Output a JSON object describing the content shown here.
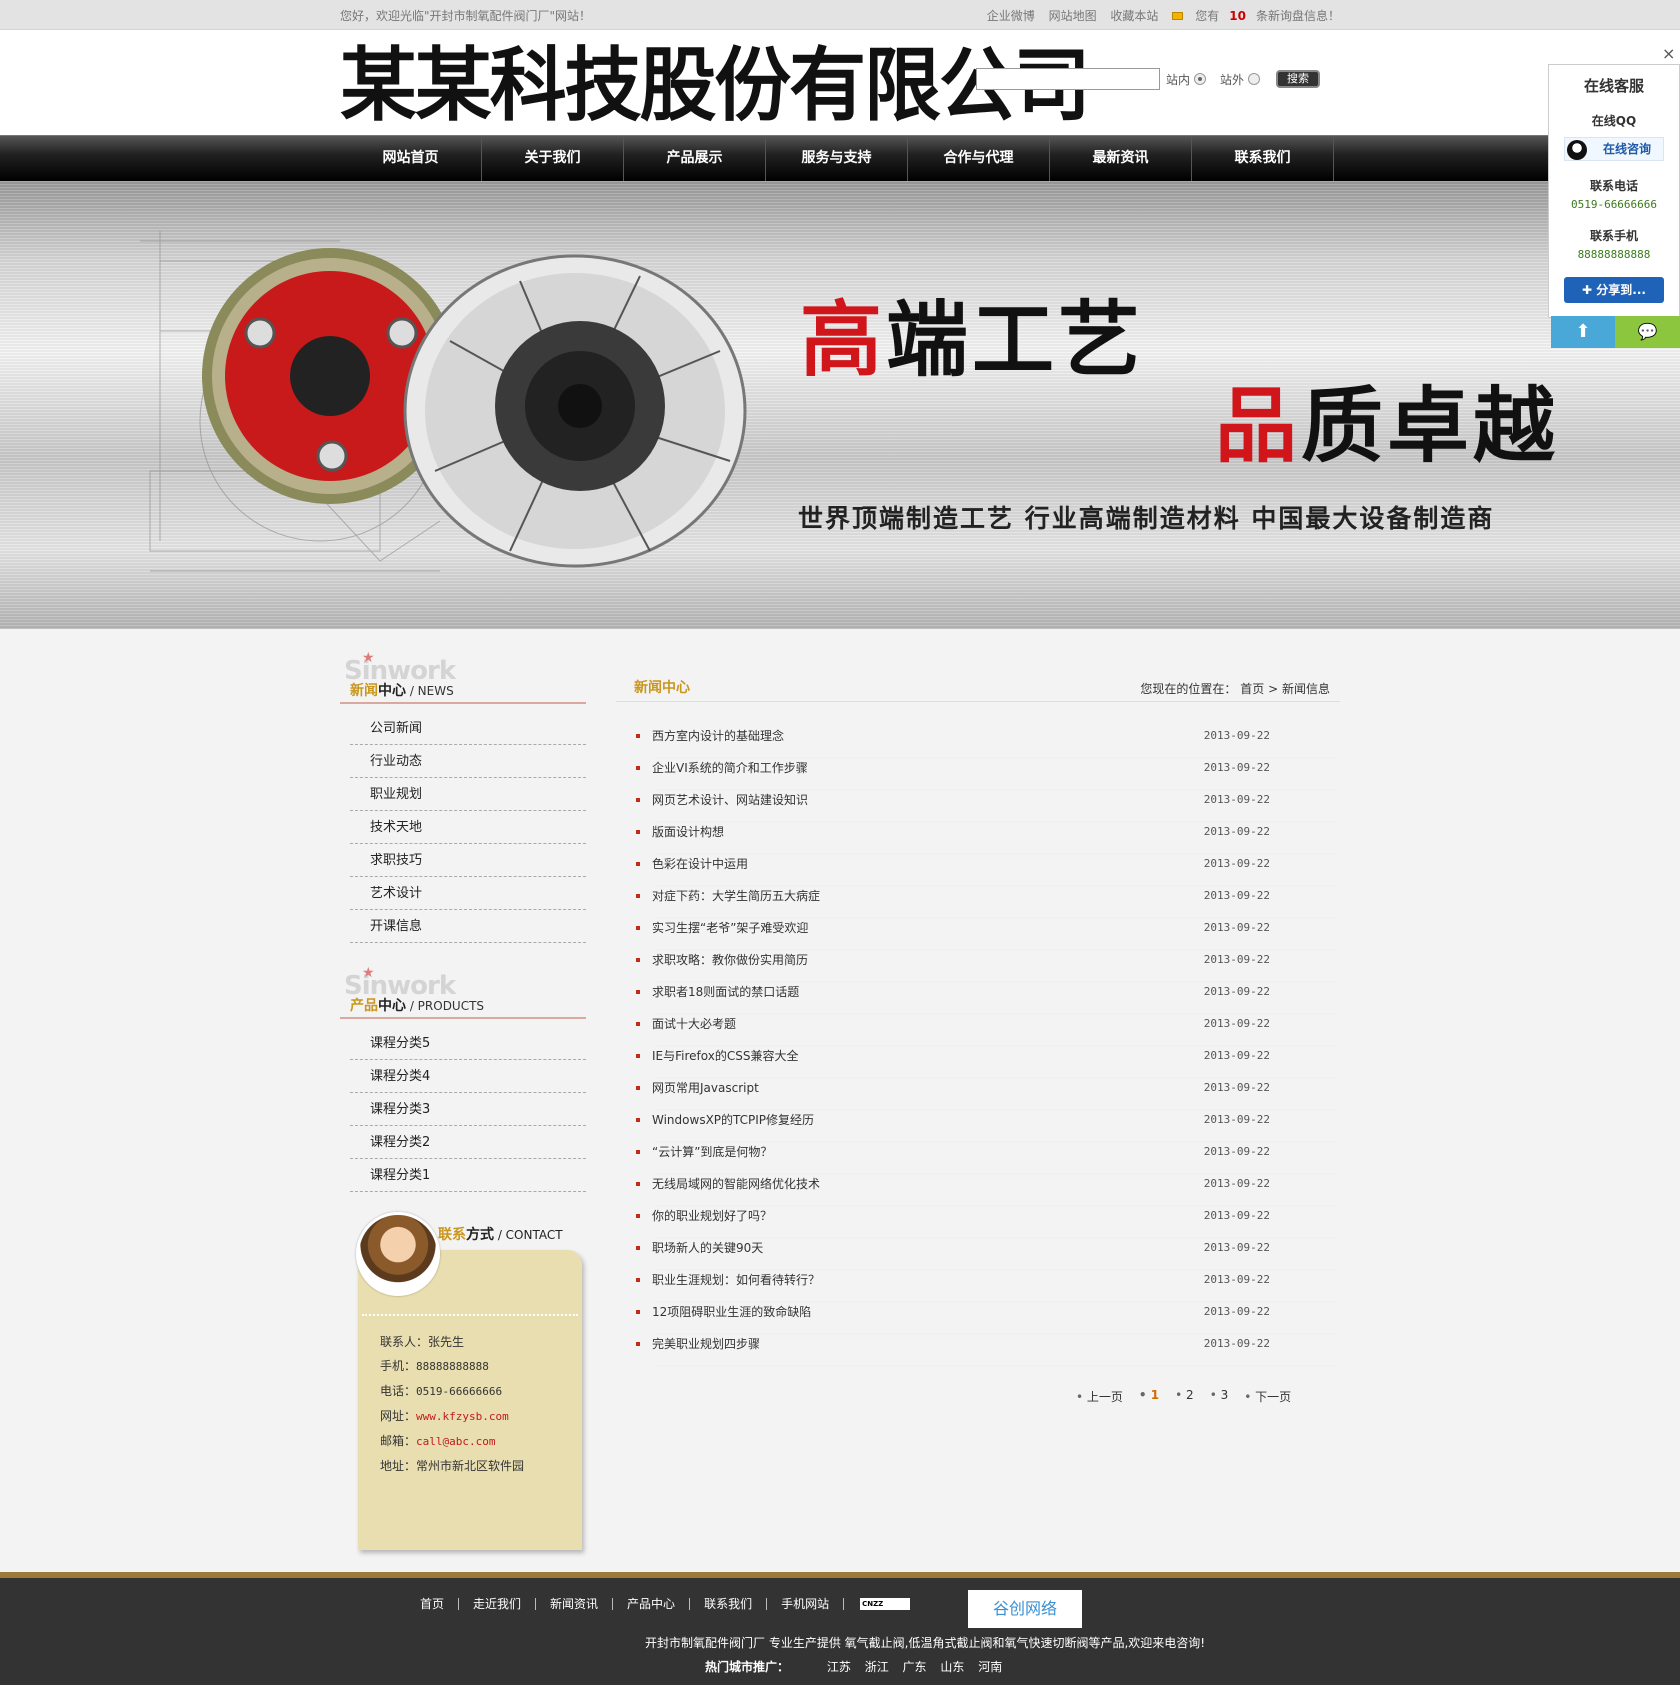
{
  "topbar": {
    "welcome": "您好，欢迎光临\"开封市制氧配件阀门厂\"网站！",
    "links": [
      "企业微博",
      "网站地图",
      "收藏本站"
    ],
    "msg_prefix": "您有",
    "msg_count": "10",
    "msg_suffix": "条新询盘信息！"
  },
  "header": {
    "logo": "某某科技股份有限公司",
    "search_placeholder": "",
    "scope_inside": "站内",
    "scope_outside": "站外",
    "search_button": "搜索"
  },
  "nav": [
    "网站首页",
    "关于我们",
    "产品展示",
    "服务与支持",
    "合作与代理",
    "最新资讯",
    "联系我们"
  ],
  "banner": {
    "slogan1_red": "高",
    "slogan1_rest": "端工艺",
    "slogan2_red": "品",
    "slogan2_rest": "质卓越",
    "tagline": "世界顶端制造工艺  行业高端制造材料  中国最大设备制造商"
  },
  "sidebar": {
    "news_head": {
      "bg": "Sinwork",
      "gold": "新闻",
      "dark": "中心",
      "en": " / NEWS"
    },
    "news_items": [
      "公司新闻",
      "行业动态",
      "职业规划",
      "技术天地",
      "求职技巧",
      "艺术设计",
      "开课信息"
    ],
    "prod_head": {
      "bg": "Sinwork",
      "gold": "产品",
      "dark": "中心",
      "en": " / PRODUCTS"
    },
    "prod_items": [
      "课程分类5",
      "课程分类4",
      "课程分类3",
      "课程分类2",
      "课程分类1"
    ],
    "contact": {
      "gold": "联系",
      "dark": "方式",
      "en": " / CONTACT",
      "person_label": "联系人：",
      "person": "张先生",
      "mobile_label": "手机：",
      "mobile": "88888888888",
      "phone_label": "电话：",
      "phone": "0519-66666666",
      "web_label": "网址：",
      "web": "www.kfzysb.com",
      "email_label": "邮箱：",
      "email": "call@abc.com",
      "addr_label": "地址：",
      "addr": "常州市新北区软件园"
    }
  },
  "content": {
    "title": "新闻中心",
    "crumb_prefix": "您现在的位置在：",
    "crumb_home": "首页",
    "crumb_sep": ">",
    "crumb_current": "新闻信息",
    "news": [
      {
        "title": "西方室内设计的基础理念",
        "date": "2013-09-22"
      },
      {
        "title": "企业VI系统的简介和工作步骤",
        "date": "2013-09-22"
      },
      {
        "title": "网页艺术设计、网站建设知识",
        "date": "2013-09-22"
      },
      {
        "title": "版面设计构想",
        "date": "2013-09-22"
      },
      {
        "title": "色彩在设计中运用",
        "date": "2013-09-22"
      },
      {
        "title": "对症下药：大学生简历五大病症",
        "date": "2013-09-22"
      },
      {
        "title": "实习生摆“老爷”架子难受欢迎",
        "date": "2013-09-22"
      },
      {
        "title": "求职攻略：教你做份实用简历",
        "date": "2013-09-22"
      },
      {
        "title": "求职者18则面试的禁口话题",
        "date": "2013-09-22"
      },
      {
        "title": "面试十大必考题",
        "date": "2013-09-22"
      },
      {
        "title": "IE与Firefox的CSS兼容大全",
        "date": "2013-09-22"
      },
      {
        "title": "网页常用Javascript",
        "date": "2013-09-22"
      },
      {
        "title": "WindowsXP的TCPIP修复经历",
        "date": "2013-09-22"
      },
      {
        "title": "“云计算”到底是何物？",
        "date": "2013-09-22"
      },
      {
        "title": "无线局域网的智能网络优化技术",
        "date": "2013-09-22"
      },
      {
        "title": "你的职业规划好了吗？",
        "date": "2013-09-22"
      },
      {
        "title": "职场新人的关键90天",
        "date": "2013-09-22"
      },
      {
        "title": "职业生涯规划：如何看待转行？",
        "date": "2013-09-22"
      },
      {
        "title": "12项阻碍职业生涯的致命缺陷",
        "date": "2013-09-22"
      },
      {
        "title": "完美职业规划四步骤",
        "date": "2013-09-22"
      }
    ],
    "pager": {
      "prev": "上一页",
      "pages": [
        "1",
        "2",
        "3"
      ],
      "current": "1",
      "next": "下一页"
    }
  },
  "float": {
    "title": "在线客服",
    "qq_label": "在线QQ",
    "qq_button": "在线咨询",
    "phone_label": "联系电话",
    "phone": "0519-66666666",
    "mobile_label": "联系手机",
    "mobile": "88888888888",
    "share": "分享到...",
    "close": "×"
  },
  "footer": {
    "links": [
      "首页",
      "走近我们",
      "新闻资讯",
      "产品中心",
      "联系我们",
      "手机网站"
    ],
    "cnzz": "CNZZ",
    "badge": "谷创网络",
    "line1": "开封市制氧配件阀门厂 专业生产提供 氧气截止阀,低温角式截止阀和氧气快速切断阀等产品,欢迎来电咨询!",
    "hot_label": "热门城市推广：",
    "cities": [
      "江苏",
      "浙江",
      "广东",
      "山东",
      "河南"
    ]
  },
  "colors": {
    "accent_gold": "#c9971e",
    "red": "#d0151b",
    "nav_bg": "#000000",
    "footer_bg": "#333333"
  }
}
